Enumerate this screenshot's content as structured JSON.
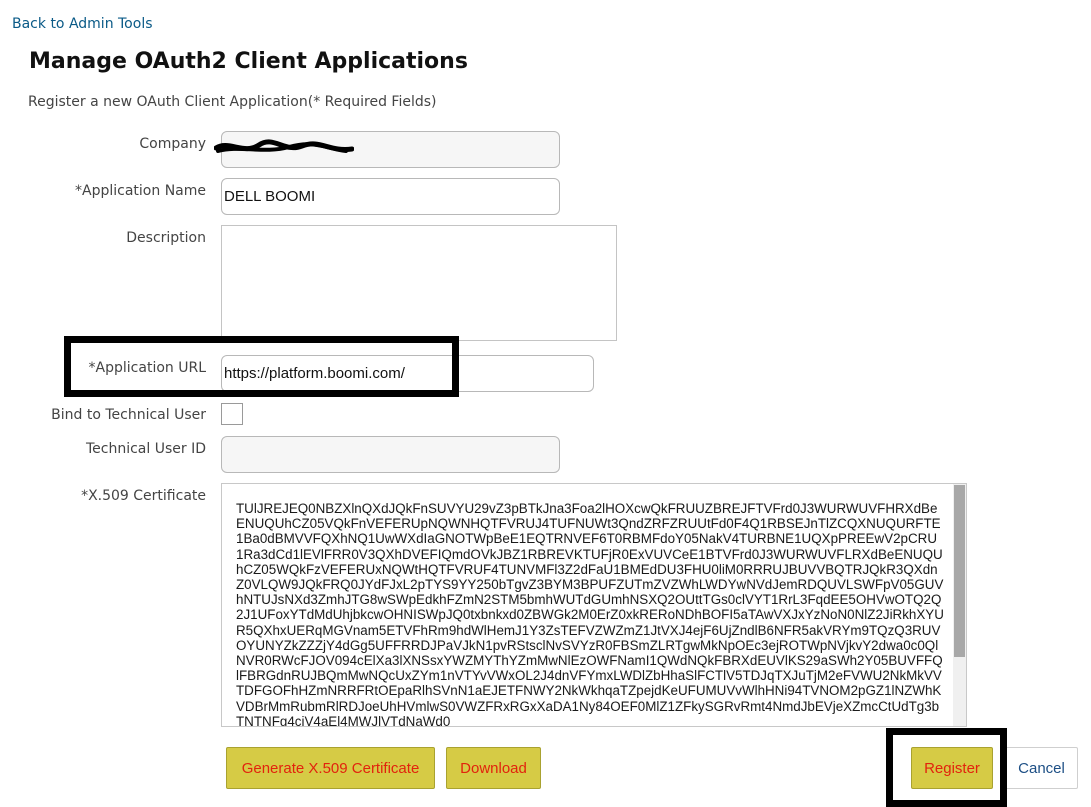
{
  "nav": {
    "back_link": "Back to Admin Tools"
  },
  "page": {
    "title": "Manage OAuth2 Client Applications",
    "subtitle": "Register a new OAuth Client Application(* Required Fields)"
  },
  "form": {
    "company": {
      "label": "Company",
      "value": ""
    },
    "app_name": {
      "label": "*Application Name",
      "value": "DELL BOOMI"
    },
    "description": {
      "label": "Description",
      "value": ""
    },
    "app_url": {
      "label": "*Application URL",
      "value": "https://platform.boomi.com/"
    },
    "bind_tech_user": {
      "label": "Bind to Technical User",
      "checked": false
    },
    "tech_user_id": {
      "label": "Technical User ID",
      "value": ""
    },
    "certificate": {
      "label": "*X.509 Certificate",
      "value": "TUlJREJEQ0NBZXlnQXdJQkFnSUVYU29vZ3pBTkJna3Foa2lHOXcwQkFRUUZBREJFTVFrd0J3WURWUVFHRXdBeENUQUhCZ05VQkFnVEFERUpNQWNHQTFVRUJ4TUFNUWt3QndZRFZRUUtFd0F4Q1RBSEJnTlZCQXNUQURFTE1Ba0dBMVVFQXhNQ1UwWXdIaGNOTWpBeE1EQTRNVEF6T0RBMFdoY05NakV4TURBNE1UQXpPREEwV2pCRU1Ra3dCd1lEVlFRR0V3QXhDVEFIQmdOVkJBZ1RBREVKTUFjR0ExVUVCeE1BTVFrd0J3WURWUVFLRXdBeENUQUhCZ05WQkFzVEFERUxNQWtHQTFVRUF4TUNVMFl3Z2dFaU1BMEdDU3FHU0liM0RRRUJBUVVBQTRJQkR3QXdnZ0VLQW9JQkFRQ0JYdFJxL2pTYS9YY250bTgvZ3BYM3BPUFZUTmZVZWhLWDYwNVdJemRDQUVLSWFpV05GUVhNTUJsNXd3ZmhJTG8wSWpEdkhFZmN2STM5bmhWUTdGUmhNSXQ2OUttTGs0clVYT1RrL3FqdEE5OHVwOTQ2Q2J1UFoxYTdMdUhjbkcwOHNISWpJQ0txbnkxd0ZBWGk2M0ErZ0xkRERoNDhBOFI5aTAwVXJxYzNoN0NlZ2JiRkhXYUR5QXhxUERqMGVnam5ETVFhRm9hdWlHemJ1Y3ZsTEFVZWZmZ1JtVXJ4ejF6UjZndlB6NFR5akVRYm9TQzQ3RUVOYUNYZkZZZjY4dGg5UFFRRDJPaVJkN1pvRStsclNvSVYzR0FBSmZLRTgwMkNpOEc3ejROTWpNVjkvY2dwa0c0QlNVR0RWcFJOV094cElXa3lXNSsxYWZMYThYZmMwNlEzOWFNamI1QWdNQkFBRXdEUVlKS29aSWh2Y05BUVFFQlFBRGdnRUJBQmMwNQcUxZYm1nVTYvVWxOL2J4dnVFYmxLWDlZbHhaSlFCTlV5TDJqTXJuTjM2eFVWU2NkMkVVTDFGOFhHZmNRRFRtOEpaRlhSVnN1aEJETFNWY2NkWkhqaTZpejdKeUFUMUVvWlhHNi94TVNOM2pGZ1lNZWhKVDBrMmRubmRlRDJoeUhHVmlwS0VWZFRxRGxXaDA1Ny84OEF0MlZ1ZFkySGRvRmt4NmdJbEVjeXZmcCtUdTg3bTNTNFg4cjV4aEl4MWJlVTdNaWd0"
    }
  },
  "buttons": {
    "generate_cert": "Generate X.509 Certificate",
    "download": "Download",
    "register": "Register",
    "cancel": "Cancel"
  },
  "colors": {
    "link": "#0a5a87",
    "button_yellow": "#d6cb45",
    "button_text_red": "#e2230d",
    "highlight_box": "#000000"
  }
}
